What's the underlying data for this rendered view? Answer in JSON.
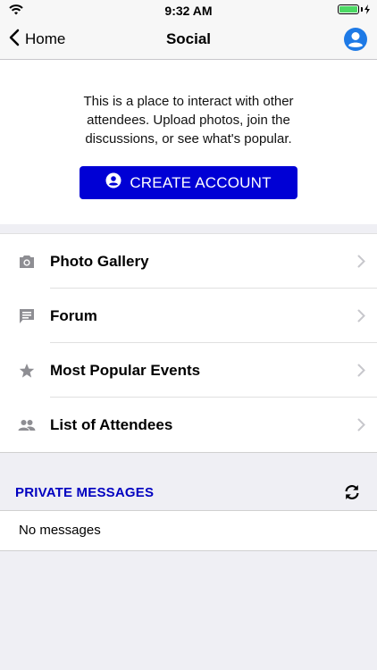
{
  "status_bar": {
    "time": "9:32 AM"
  },
  "nav": {
    "back_label": "Home",
    "title": "Social"
  },
  "intro": {
    "text": "This is a place to interact with other attendees. Upload photos, join the discussions, or see what's popular.",
    "create_account_label": "CREATE ACCOUNT"
  },
  "menu": {
    "items": [
      {
        "label": "Photo Gallery",
        "icon": "camera-icon"
      },
      {
        "label": "Forum",
        "icon": "message-icon"
      },
      {
        "label": "Most Popular Events",
        "icon": "star-icon"
      },
      {
        "label": "List of Attendees",
        "icon": "people-icon"
      }
    ]
  },
  "private_messages": {
    "title": "PRIVATE MESSAGES",
    "empty_text": "No messages"
  },
  "colors": {
    "accent": "#0000d5",
    "section_title": "#0000c0",
    "profile_icon": "#1e7ae6",
    "battery": "#4cd964"
  }
}
